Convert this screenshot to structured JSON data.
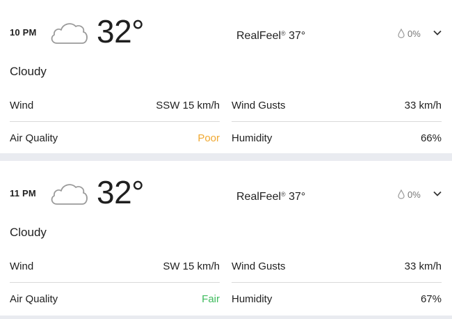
{
  "forecast": [
    {
      "time": "10 PM",
      "temperature": "32°",
      "icon": "cloud-icon",
      "realfeel_label": "RealFeel",
      "realfeel_mark": "®",
      "realfeel_value": "37°",
      "precip_icon": "raindrop-icon",
      "precip": "0%",
      "condition": "Cloudy",
      "wind_label": "Wind",
      "wind": "SSW 15 km/h",
      "gusts_label": "Wind Gusts",
      "gusts": "33 km/h",
      "air_quality_label": "Air Quality",
      "air_quality": "Poor",
      "air_quality_color": "#f0a830",
      "humidity_label": "Humidity",
      "humidity": "66%"
    },
    {
      "time": "11 PM",
      "temperature": "32°",
      "icon": "cloud-icon",
      "realfeel_label": "RealFeel",
      "realfeel_mark": "®",
      "realfeel_value": "37°",
      "precip_icon": "raindrop-icon",
      "precip": "0%",
      "condition": "Cloudy",
      "wind_label": "Wind",
      "wind": "SW 15 km/h",
      "gusts_label": "Wind Gusts",
      "gusts": "33 km/h",
      "air_quality_label": "Air Quality",
      "air_quality": "Fair",
      "air_quality_color": "#3dbb5c",
      "humidity_label": "Humidity",
      "humidity": "67%"
    }
  ]
}
